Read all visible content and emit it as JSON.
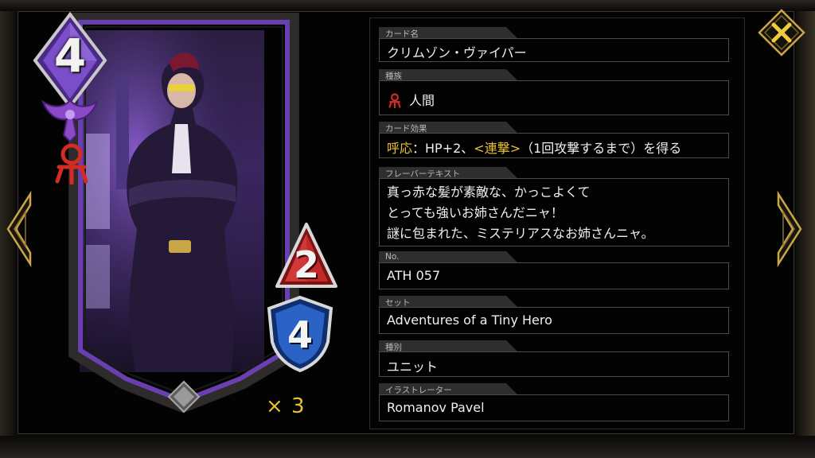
{
  "card": {
    "cost": "4",
    "attack": "2",
    "hp": "4",
    "copies": "× 3"
  },
  "info": {
    "name": {
      "label": "カード名",
      "value": "クリムゾン・ヴァイパー"
    },
    "race": {
      "label": "種族",
      "value": "人間",
      "icon": "race-human-icon"
    },
    "effect": {
      "label": "カード効果",
      "keyword": "呼応",
      "text1": "：HP+2、",
      "highlight": "<連撃>",
      "text2": "（1回攻撃するまで）を得る"
    },
    "flavor": {
      "label": "フレーバーテキスト",
      "lines": [
        "真っ赤な髪が素敵な、かっこよくて",
        "とっても強いお姉さんだニャ！",
        "謎に包まれた、ミステリアスなお姉さんニャ。"
      ]
    },
    "number": {
      "label": "No.",
      "value": "ATH 057"
    },
    "set": {
      "label": "セット",
      "value": "Adventures of a Tiny Hero"
    },
    "type": {
      "label": "種別",
      "value": "ユニット"
    },
    "illustrator": {
      "label": "イラストレーター",
      "value": "Romanov Pavel"
    }
  },
  "colors": {
    "accent_gold": "#e9c230",
    "card_purple": "#6a3fb0",
    "race_red": "#d42b23",
    "attack_red": "#b51f1f",
    "hp_blue": "#1d4fb0"
  },
  "icons": [
    "close-icon",
    "chevron-left-icon",
    "chevron-right-icon",
    "race-human-icon",
    "tribe-emblem-icon",
    "rarity-gem-icon"
  ]
}
